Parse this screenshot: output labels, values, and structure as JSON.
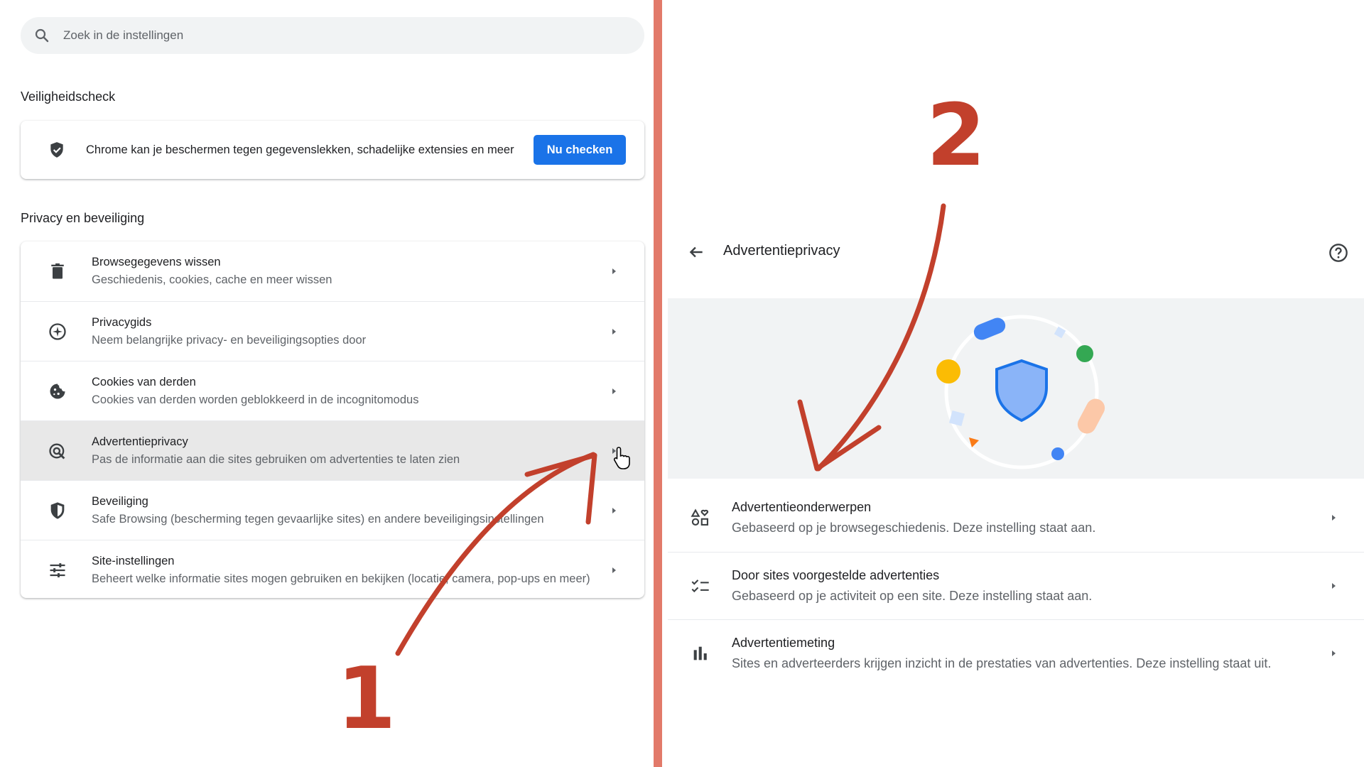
{
  "search": {
    "placeholder": "Zoek in de instellingen"
  },
  "safety_check": {
    "title": "Veiligheidscheck",
    "text": "Chrome kan je beschermen tegen gegevenslekken, schadelijke extensies en meer",
    "button": "Nu checken"
  },
  "privacy": {
    "title": "Privacy en beveiliging",
    "items": [
      {
        "label": "Browsegegevens wissen",
        "desc": "Geschiedenis, cookies, cache en meer wissen",
        "icon": "trash-icon"
      },
      {
        "label": "Privacygids",
        "desc": "Neem belangrijke privacy- en beveiligingsopties door",
        "icon": "compass-icon"
      },
      {
        "label": "Cookies van derden",
        "desc": "Cookies van derden worden geblokkeerd in de incognitomodus",
        "icon": "cookie-icon"
      },
      {
        "label": "Advertentieprivacy",
        "desc": "Pas de informatie aan die sites gebruiken om advertenties te laten zien",
        "icon": "ad-privacy-icon",
        "highlighted": true
      },
      {
        "label": "Beveiliging",
        "desc": "Safe Browsing (bescherming tegen gevaarlijke sites) en andere beveiligingsinstellingen",
        "icon": "shield-icon"
      },
      {
        "label": "Site-instellingen",
        "desc": "Beheert welke informatie sites mogen gebruiken en bekijken (locatie, camera, pop-ups en meer)",
        "icon": "sliders-icon"
      }
    ]
  },
  "ad_privacy": {
    "title": "Advertentieprivacy",
    "items": [
      {
        "label": "Advertentieonderwerpen",
        "desc": "Gebaseerd op je browsegeschiedenis. Deze instelling staat aan.",
        "icon": "topics-icon"
      },
      {
        "label": "Door sites voorgestelde advertenties",
        "desc": "Gebaseerd op je activiteit op een site. Deze instelling staat aan.",
        "icon": "checklist-icon"
      },
      {
        "label": "Advertentiemeting",
        "desc": "Sites en adverteerders krijgen inzicht in de prestaties van advertenties. Deze instelling staat uit.",
        "icon": "bar-chart-icon"
      }
    ]
  },
  "annotations": {
    "step1": "1",
    "step2": "2"
  },
  "colors": {
    "accent": "#1a73e8",
    "annotation": "#c2402c",
    "divider": "#e27a6a"
  }
}
